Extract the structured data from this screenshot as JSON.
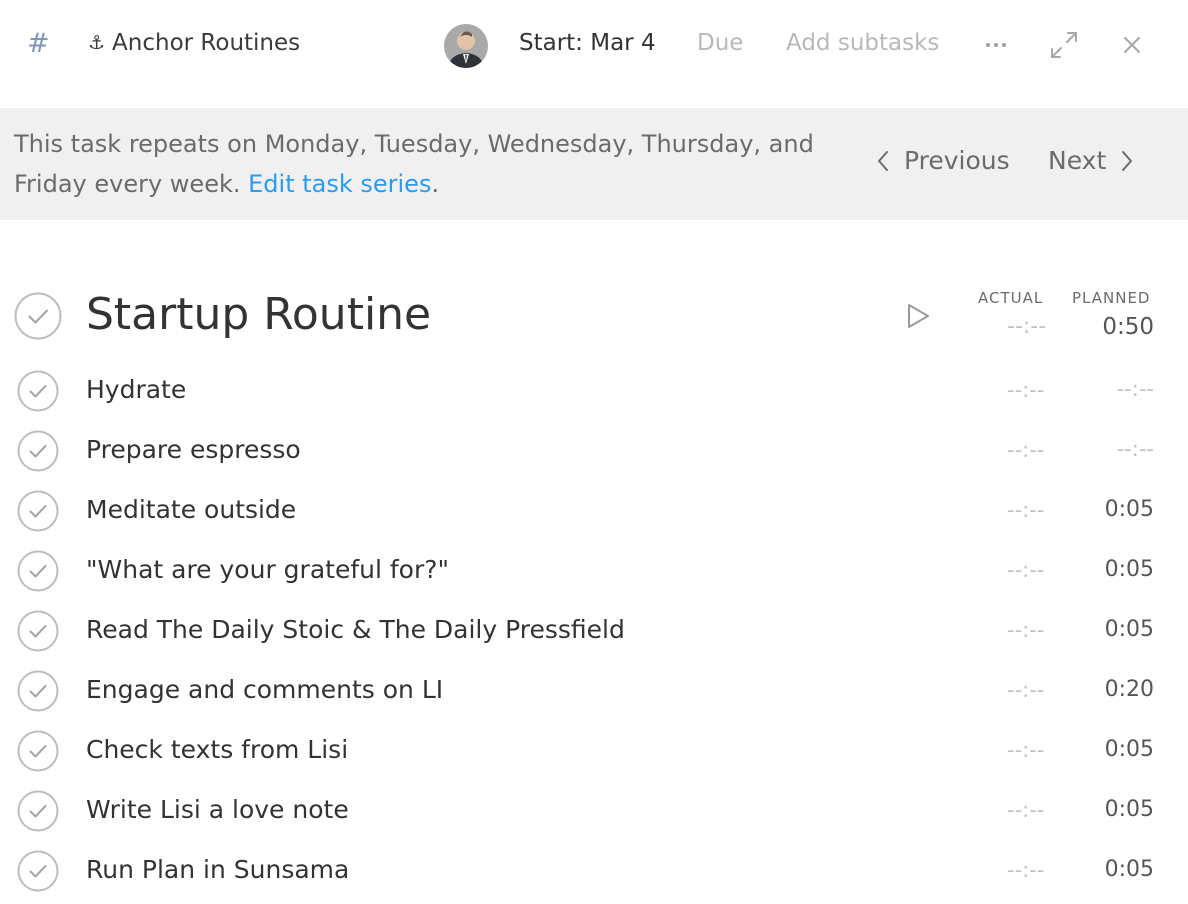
{
  "header": {
    "hash_icon": "hash-icon",
    "channel_icon": "anchor-icon",
    "channel_label": "Anchor Routines",
    "avatar_icon": "user-avatar",
    "start_label": "Start: Mar 4",
    "due_label": "Due",
    "add_subtasks_label": "Add subtasks"
  },
  "banner": {
    "repeat_text": "This task repeats on Monday, Tuesday, Wednesday, Thursday, and Friday every week. ",
    "edit_link": "Edit task series",
    "period": ".",
    "previous_label": "Previous",
    "next_label": "Next"
  },
  "task": {
    "title": "Startup Routine",
    "actual_header": "ACTUAL",
    "planned_header": "PLANNED",
    "actual": "--:--",
    "planned": "0:50"
  },
  "subtasks": [
    {
      "label": "Hydrate",
      "actual": "--:--",
      "planned": "--:--"
    },
    {
      "label": "Prepare espresso",
      "actual": "--:--",
      "planned": "--:--"
    },
    {
      "label": "Meditate outside",
      "actual": "--:--",
      "planned": "0:05"
    },
    {
      "label": "\"What are your grateful for?\"",
      "actual": "--:--",
      "planned": "0:05"
    },
    {
      "label": "Read The Daily Stoic & The Daily Pressfield",
      "actual": "--:--",
      "planned": "0:05"
    },
    {
      "label": "Engage and comments on LI",
      "actual": "--:--",
      "planned": "0:20"
    },
    {
      "label": "Check texts from Lisi",
      "actual": "--:--",
      "planned": "0:05"
    },
    {
      "label": "Write Lisi a love note",
      "actual": "--:--",
      "planned": "0:05"
    },
    {
      "label": "Run Plan in Sunsama",
      "actual": "--:--",
      "planned": "0:05"
    }
  ],
  "colors": {
    "link": "#2b9bed",
    "banner_bg": "#f0f0f0",
    "hash": "#7f96b4",
    "muted": "#b8b8b8"
  }
}
